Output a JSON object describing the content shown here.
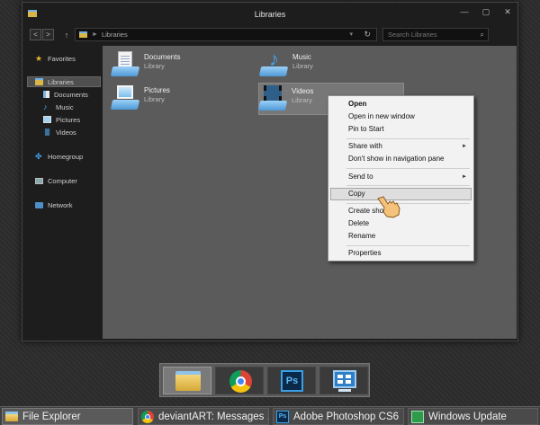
{
  "window": {
    "title": "Libraries",
    "controls": {
      "minimize": "—",
      "maximize": "▢",
      "close": "✕"
    }
  },
  "addressbar": {
    "back": "<",
    "forward": ">",
    "up": "↑",
    "separator": "►",
    "path": "Libraries",
    "dropdown": "▾",
    "refresh": "↻",
    "search_placeholder": "Search Libraries",
    "search_icon": "⌕"
  },
  "sidebar": {
    "favorites": "Favorites",
    "libraries": "Libraries",
    "documents": "Documents",
    "music": "Music",
    "pictures": "Pictures",
    "videos": "Videos",
    "homegroup": "Homegroup",
    "computer": "Computer",
    "network": "Network",
    "icons": {
      "star": "★",
      "music": "♪",
      "homegroup": "✤"
    }
  },
  "libraries": [
    {
      "name": "Documents",
      "type": "Library"
    },
    {
      "name": "Music",
      "type": "Library",
      "note_glyph": "♪"
    },
    {
      "name": "Pictures",
      "type": "Library"
    },
    {
      "name": "Videos",
      "type": "Library"
    }
  ],
  "context_menu": {
    "open": "Open",
    "open_new_window": "Open in new window",
    "pin_to_start": "Pin to Start",
    "share_with": "Share with",
    "dont_show": "Don't show in navigation pane",
    "send_to": "Send to",
    "copy": "Copy",
    "create_shortcut": "Create shortcut",
    "delete": "Delete",
    "rename": "Rename",
    "properties": "Properties",
    "submenu_arrow": "►"
  },
  "dock": {
    "items": [
      "file-explorer",
      "chrome",
      "photoshop",
      "windows-update"
    ],
    "ps_label": "Ps"
  },
  "taskbar": {
    "items": [
      {
        "label": "File Explorer"
      },
      {
        "label": "deviantART: Messages ..."
      },
      {
        "label": "Adobe Photoshop CS6"
      },
      {
        "label": "Windows Update"
      }
    ],
    "ps_label": "Ps"
  },
  "colors": {
    "content_bg": "#5b5b5b",
    "sidebar_bg": "#1d1d1d",
    "menu_bg": "#f2f2f2",
    "taskbar_bg": "#404040"
  }
}
